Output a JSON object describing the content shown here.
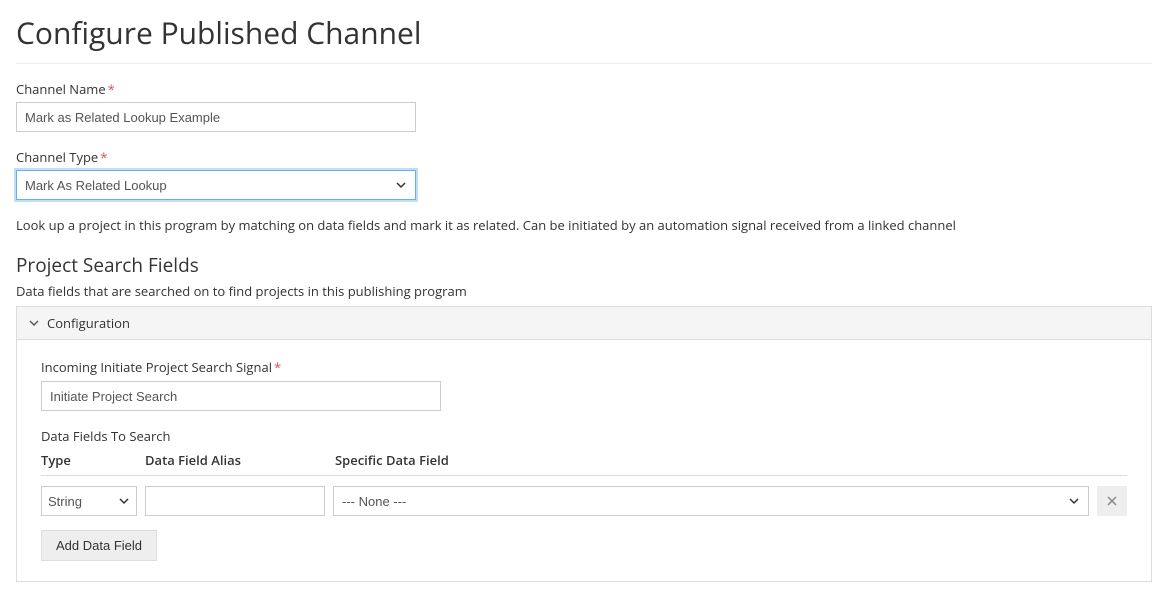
{
  "page_title": "Configure Published Channel",
  "channel_name": {
    "label": "Channel Name",
    "value": "Mark as Related Lookup Example"
  },
  "channel_type": {
    "label": "Channel Type",
    "value": "Mark As Related Lookup",
    "description": "Look up a project in this program by matching on data fields and mark it as related. Can be initiated by an automation signal received from a linked channel"
  },
  "search_fields": {
    "heading": "Project Search Fields",
    "sub_description": "Data fields that are searched on to find projects in this publishing program",
    "config_title": "Configuration",
    "signal": {
      "label": "Incoming Initiate Project Search Signal",
      "value": "Initiate Project Search"
    },
    "fields_title": "Data Fields To Search",
    "columns": {
      "type": "Type",
      "alias": "Data Field Alias",
      "specific": "Specific Data Field"
    },
    "row": {
      "type": "String",
      "alias": "",
      "specific": "--- None ---"
    },
    "add_button": "Add Data Field"
  }
}
